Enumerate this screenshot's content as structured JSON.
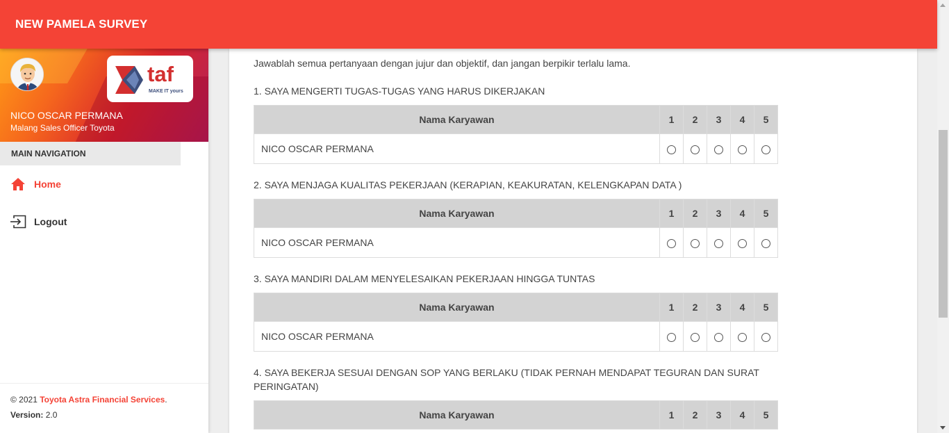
{
  "header": {
    "title": "NEW PAMELA SURVEY"
  },
  "user": {
    "name": "NICO OSCAR PERMANA",
    "role": "Malang Sales Officer Toyota"
  },
  "logo": {
    "text": "taf",
    "tagline": "MAKE IT yours"
  },
  "nav": {
    "header": "MAIN NAVIGATION",
    "items": [
      {
        "label": "Home",
        "icon": "home-icon"
      },
      {
        "label": "Logout",
        "icon": "logout-icon"
      }
    ]
  },
  "footer": {
    "copyright": "© 2021",
    "company": "Toyota Astra Financial Services",
    "dot": ".",
    "version_label": "Version:",
    "version": "2.0"
  },
  "survey": {
    "intro": "Jawablah semua pertanyaan dengan jujur dan objektif, dan jangan berpikir terlalu lama.",
    "column_header": "Nama Karyawan",
    "scale": [
      "1",
      "2",
      "3",
      "4",
      "5"
    ],
    "questions": [
      {
        "text": "1. SAYA MENGERTI TUGAS-TUGAS YANG HARUS DIKERJAKAN",
        "employee": "NICO OSCAR PERMANA"
      },
      {
        "text": "2. SAYA MENJAGA KUALITAS PEKERJAAN (KERAPIAN, KEAKURATAN, KELENGKAPAN DATA )",
        "employee": "NICO OSCAR PERMANA"
      },
      {
        "text": "3. SAYA MANDIRI DALAM MENYELESAIKAN PEKERJAAN HINGGA TUNTAS",
        "employee": "NICO OSCAR PERMANA"
      },
      {
        "text": "4. SAYA BEKERJA SESUAI DENGAN SOP YANG BERLAKU (TIDAK PERNAH MENDAPAT TEGURAN DAN SURAT PERINGATAN)",
        "employee": ""
      }
    ]
  },
  "colors": {
    "primary": "#f44336",
    "header_cell": "#d3d3d3"
  }
}
